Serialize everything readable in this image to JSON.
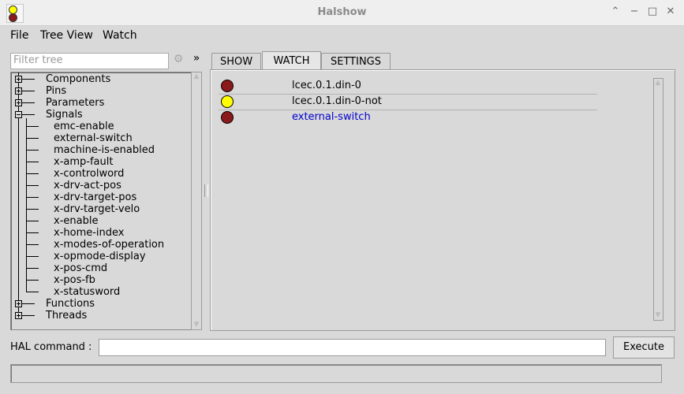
{
  "window": {
    "title": "Halshow",
    "minimize_glyph": "⌃",
    "restore_glyph": "−",
    "maximize_glyph": "□",
    "close_glyph": "✕"
  },
  "menu": [
    "File",
    "Tree View",
    "Watch"
  ],
  "filter": {
    "placeholder": "Filter tree",
    "gear_icon": "gear-icon",
    "expand_glyph": "»"
  },
  "tree": {
    "top_level": [
      {
        "label": "Components",
        "expanded": false
      },
      {
        "label": "Pins",
        "expanded": false
      },
      {
        "label": "Parameters",
        "expanded": false
      },
      {
        "label": "Signals",
        "expanded": true
      },
      {
        "label": "Functions",
        "expanded": false
      },
      {
        "label": "Threads",
        "expanded": false
      }
    ],
    "signals": [
      "emc-enable",
      "external-switch",
      "machine-is-enabled",
      "x-amp-fault",
      "x-controlword",
      "x-drv-act-pos",
      "x-drv-target-pos",
      "x-drv-target-velo",
      "x-enable",
      "x-home-index",
      "x-modes-of-operation",
      "x-opmode-display",
      "x-pos-cmd",
      "x-pos-fb",
      "x-statusword"
    ]
  },
  "tabs": [
    {
      "label": "SHOW",
      "active": false
    },
    {
      "label": "WATCH",
      "active": true
    },
    {
      "label": "SETTINGS",
      "active": false
    }
  ],
  "watch": [
    {
      "label": "lcec.0.1.din-0",
      "state": "off",
      "color": "#8b1a1a",
      "text_color": "#000000"
    },
    {
      "label": "lcec.0.1.din-0-not",
      "state": "on",
      "color": "#ffff00",
      "text_color": "#000000"
    },
    {
      "label": "external-switch",
      "state": "off",
      "color": "#8b1a1a",
      "text_color": "#0000cc"
    }
  ],
  "hal": {
    "label": "HAL command :",
    "value": "",
    "execute_label": "Execute"
  },
  "status": {
    "text": ""
  }
}
